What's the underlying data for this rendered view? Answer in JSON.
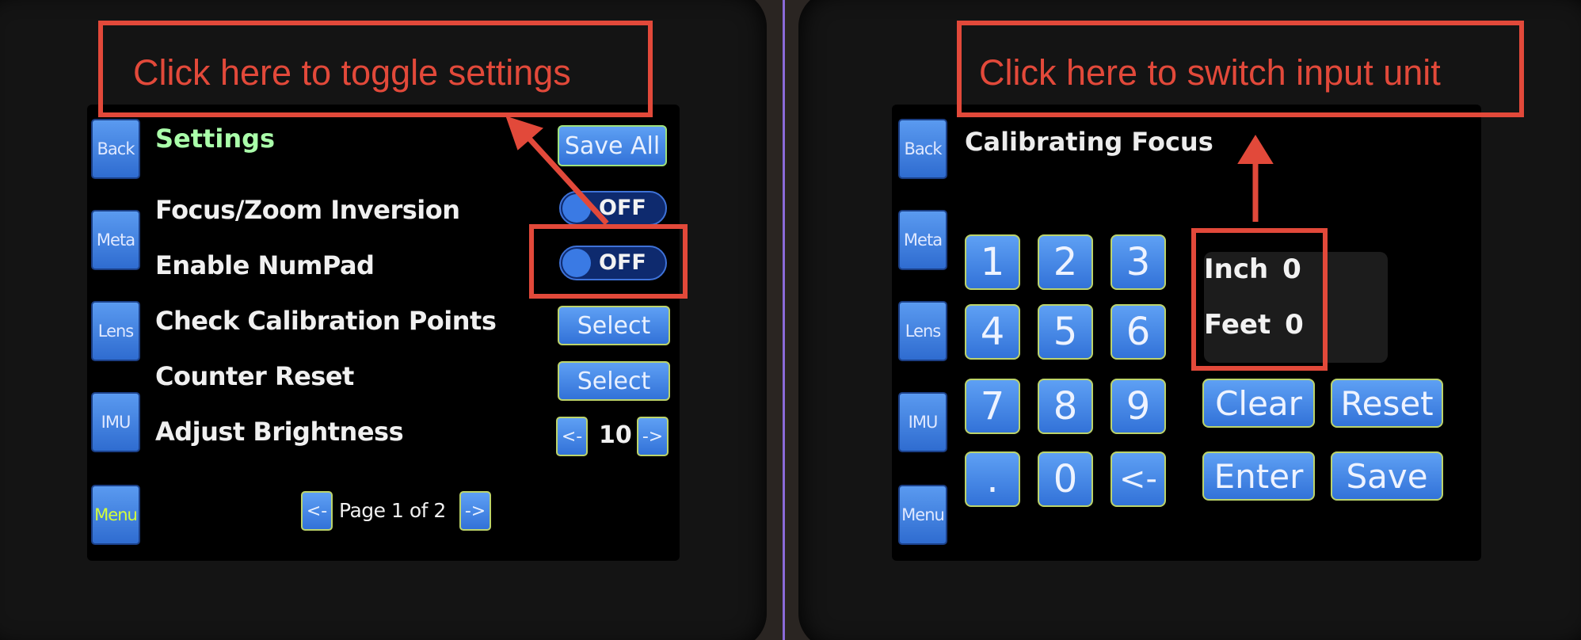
{
  "left_panel": {
    "callout_text": "Click here to toggle settings",
    "title": "Settings",
    "save_all_label": "Save All",
    "sidebar": [
      "Back",
      "Meta",
      "Lens",
      "IMU",
      "Menu"
    ],
    "rows": [
      {
        "label": "Focus/Zoom Inversion",
        "control": "toggle",
        "value": "OFF"
      },
      {
        "label": "Enable NumPad",
        "control": "toggle",
        "value": "OFF"
      },
      {
        "label": "Check Calibration Points",
        "control": "button",
        "value": "Select"
      },
      {
        "label": "Counter Reset",
        "control": "button",
        "value": "Select"
      },
      {
        "label": "Adjust Brightness",
        "control": "stepper",
        "value": "10",
        "dec": "<-",
        "inc": "->"
      }
    ],
    "pager": {
      "prev": "<-",
      "text": "Page 1 of 2",
      "next": "->"
    }
  },
  "right_panel": {
    "callout_text": "Click here to switch input unit",
    "title": "Calibrating Focus",
    "sidebar": [
      "Back",
      "Meta",
      "Lens",
      "IMU",
      "Menu"
    ],
    "keypad": [
      "1",
      "2",
      "3",
      "4",
      "5",
      "6",
      "7",
      "8",
      "9",
      ".",
      "0",
      "<-"
    ],
    "actions": {
      "clear": "Clear",
      "reset": "Reset",
      "enter": "Enter",
      "save": "Save"
    },
    "units": [
      {
        "unit": "Inch",
        "value": "0"
      },
      {
        "unit": "Feet",
        "value": "0"
      }
    ]
  },
  "colors": {
    "callout": "#e2493a",
    "accent_blue": "#3f82e6",
    "title_green": "#aaffaa",
    "divider": "#8a6ad8"
  }
}
